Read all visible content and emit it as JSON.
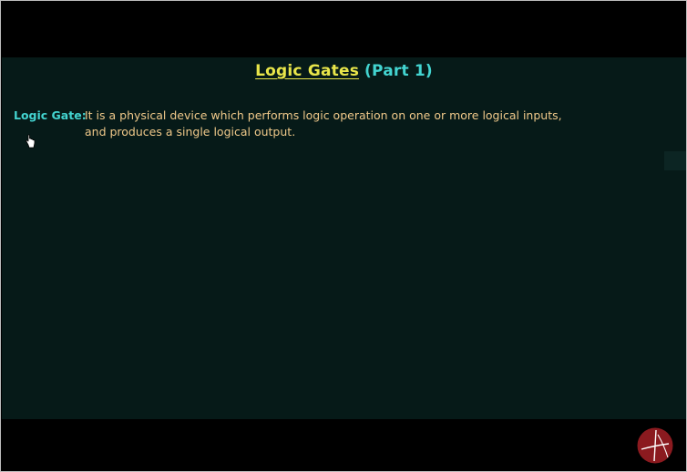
{
  "slide": {
    "title_main": "Logic Gates",
    "title_part": "(Part 1)",
    "term_label": "Logic Gate:",
    "definition_line1": "It is a physical device which performs logic operation on one or more logical inputs,",
    "definition_line2": "and produces a single logical output."
  },
  "colors": {
    "board_background": "#061a18",
    "title_main": "#e9e64a",
    "title_part": "#43d4d0",
    "term": "#43d4d0",
    "definition": "#f0c98a",
    "logo": "#8b1a1f"
  },
  "icons": {
    "cursor": "hand-pointer-icon",
    "logo": "channel-logo-icon"
  }
}
